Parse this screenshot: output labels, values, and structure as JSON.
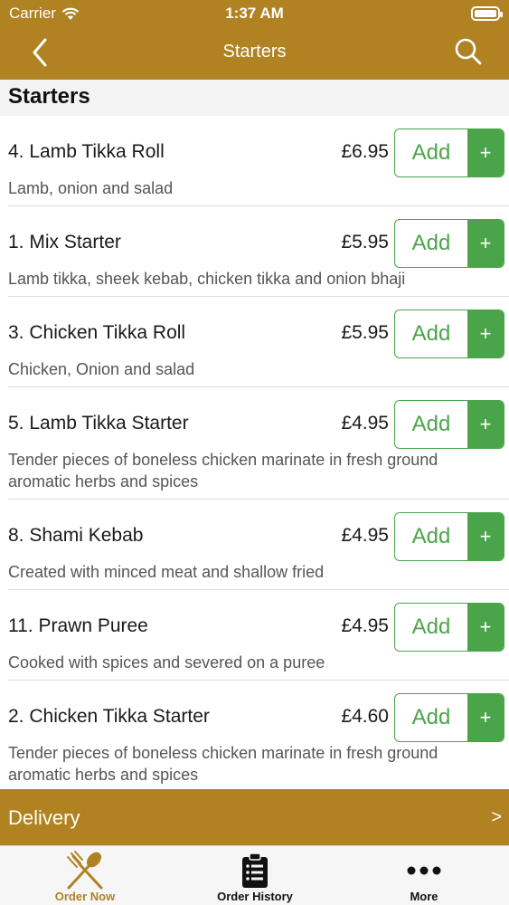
{
  "status": {
    "carrier": "Carrier",
    "time": "1:37 AM"
  },
  "nav": {
    "title": "Starters"
  },
  "section": {
    "title": "Starters"
  },
  "add_label": "Add",
  "plus_label": "+",
  "items": [
    {
      "name": "4. Lamb Tikka Roll",
      "price": "£6.95",
      "desc": "Lamb, onion and salad",
      "lines": 1
    },
    {
      "name": "1. Mix Starter",
      "price": "£5.95",
      "desc": "Lamb tikka, sheek kebab, chicken tikka and onion bhaji",
      "lines": 1
    },
    {
      "name": "3. Chicken Tikka Roll",
      "price": "£5.95",
      "desc": "Chicken, Onion and salad",
      "lines": 1
    },
    {
      "name": "5. Lamb Tikka Starter",
      "price": "£4.95",
      "desc": "Tender pieces of boneless chicken marinate in fresh ground aromatic herbs and spices",
      "lines": 2
    },
    {
      "name": "8. Shami Kebab",
      "price": "£4.95",
      "desc": "Created with minced meat and shallow fried",
      "lines": 1
    },
    {
      "name": "11. Prawn Puree",
      "price": "£4.95",
      "desc": "Cooked with spices and severed  on a puree",
      "lines": 1
    },
    {
      "name": "2. Chicken Tikka Starter",
      "price": "£4.60",
      "desc": "Tender pieces of boneless chicken marinate in fresh ground aromatic herbs and spices",
      "lines": 2
    }
  ],
  "delivery": {
    "label": "Delivery",
    "arrow": ">"
  },
  "tabs": [
    {
      "label": "Order Now",
      "icon": "cutlery-icon",
      "active": true
    },
    {
      "label": "Order History",
      "icon": "clipboard-icon",
      "active": false
    },
    {
      "label": "More",
      "icon": "more-dots-icon",
      "active": false
    }
  ],
  "colors": {
    "brand": "#b08222",
    "accent_green": "#4aa54a",
    "tab_active": "#b08222"
  }
}
